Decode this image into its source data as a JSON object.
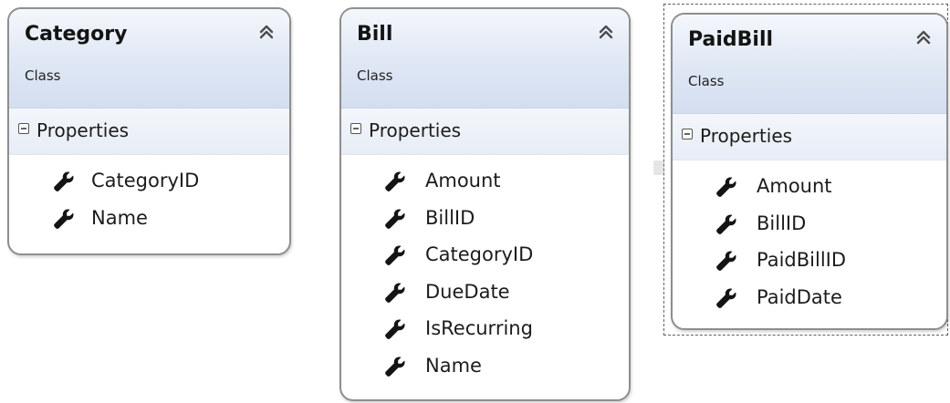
{
  "classes": [
    {
      "name": "Category",
      "stereotype": "Class",
      "compartment": "Properties",
      "properties": [
        "CategoryID",
        "Name"
      ]
    },
    {
      "name": "Bill",
      "stereotype": "Class",
      "compartment": "Properties",
      "properties": [
        "Amount",
        "BillID",
        "CategoryID",
        "DueDate",
        "IsRecurring",
        "Name"
      ]
    },
    {
      "name": "PaidBill",
      "stereotype": "Class",
      "compartment": "Properties",
      "properties": [
        "Amount",
        "BillID",
        "PaidBillID",
        "PaidDate"
      ]
    }
  ],
  "icons": {
    "collapse": "double-chevron-up-icon",
    "expander": "minus-box-icon",
    "property": "wrench-icon"
  },
  "colors": {
    "header_gradient_top": "#f4f7fc",
    "header_gradient_bottom": "#d3def0",
    "border": "#8e8e8e",
    "icon": "#141414"
  },
  "selection": {
    "selected_class": "PaidBill"
  }
}
